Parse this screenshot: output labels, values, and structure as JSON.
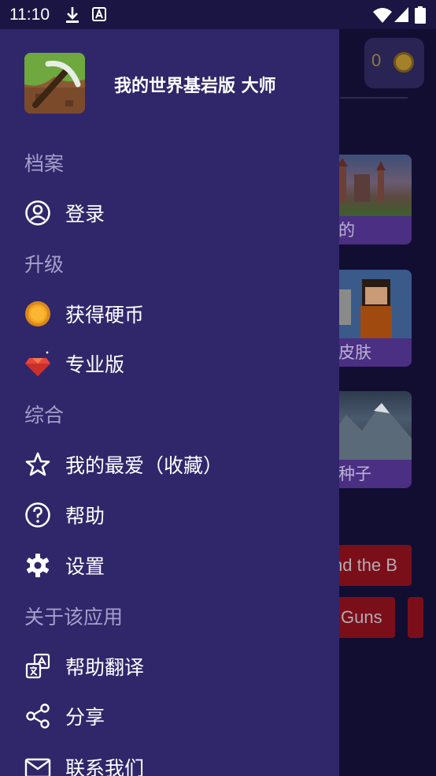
{
  "status_bar": {
    "time": "11:10"
  },
  "background": {
    "coin_count": "0",
    "cards": [
      {
        "label": "的"
      },
      {
        "label": "皮肤"
      },
      {
        "label": "种子"
      }
    ],
    "tags": [
      {
        "label": "nd the B"
      },
      {
        "label": "Guns"
      }
    ]
  },
  "drawer": {
    "app_name": "我的世界基岩版 大师",
    "sections": [
      {
        "title": "档案",
        "items": [
          {
            "label": "登录",
            "icon": "account-circle-icon"
          }
        ]
      },
      {
        "title": "升级",
        "items": [
          {
            "label": "获得硬币",
            "icon": "coin-icon"
          },
          {
            "label": "专业版",
            "icon": "diamond-icon"
          }
        ]
      },
      {
        "title": "综合",
        "items": [
          {
            "label": "我的最爱（收藏）",
            "icon": "star-outline-icon"
          },
          {
            "label": "帮助",
            "icon": "help-circle-icon"
          },
          {
            "label": "设置",
            "icon": "gear-icon"
          }
        ]
      },
      {
        "title": "关于该应用",
        "items": [
          {
            "label": "帮助翻译",
            "icon": "translate-icon"
          },
          {
            "label": "分享",
            "icon": "share-icon"
          },
          {
            "label": "联系我们",
            "icon": "mail-icon"
          }
        ]
      }
    ]
  },
  "colors": {
    "drawer_bg": "#30266a",
    "section_text": "#a59fca",
    "coin_gold": "#f5a623",
    "diamond_red": "#e8453c"
  }
}
